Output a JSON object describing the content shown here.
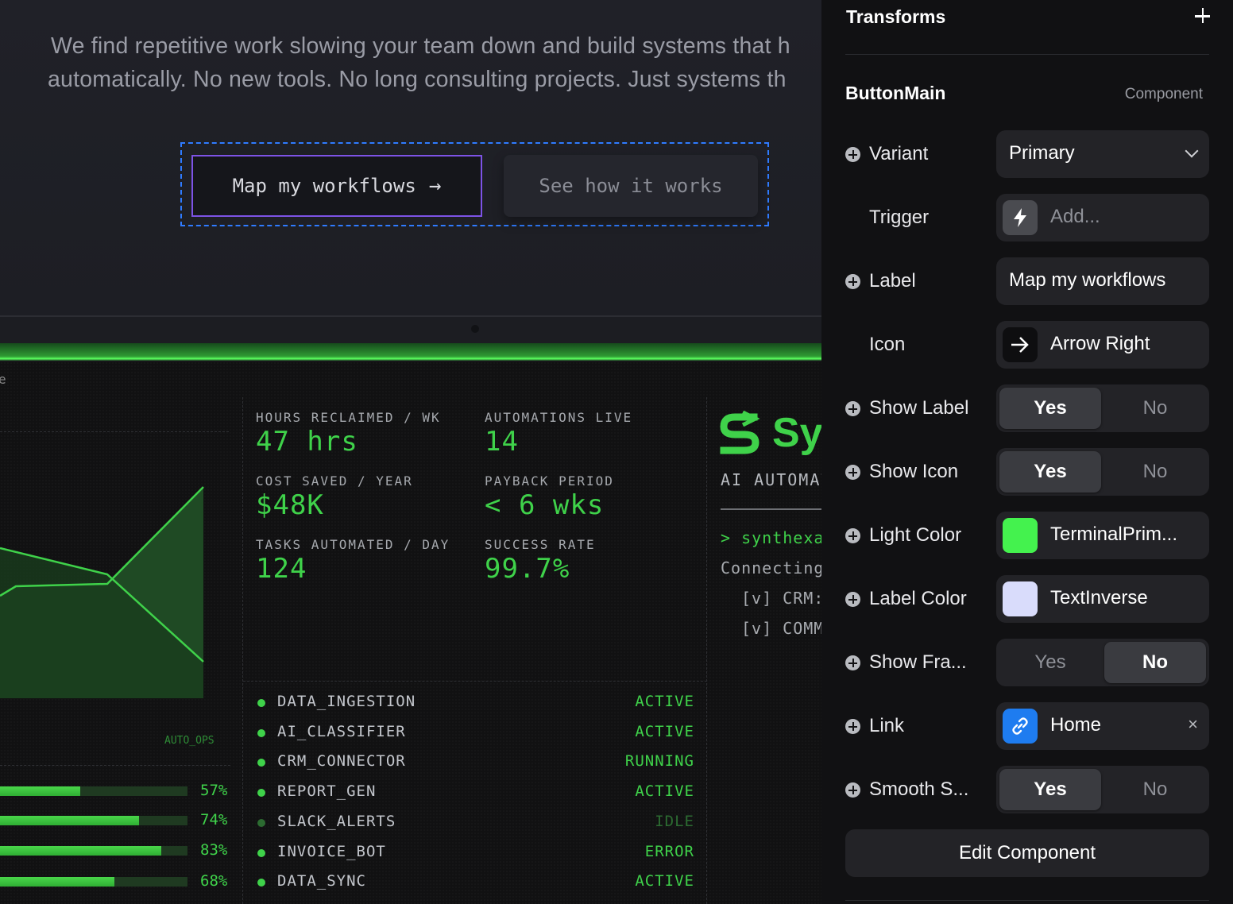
{
  "hero": {
    "line1": "We find repetitive work slowing your team down and build systems that h",
    "line2": "automatically. No new tools. No long consulting projects. Just systems th",
    "primary_cta": "Map my workflows",
    "secondary_cta": "See how it works"
  },
  "dashboard": {
    "cut_text": "e",
    "chart_label": "AUTO_OPS",
    "bars": [
      {
        "percent_label": "57%",
        "fill": 0.43
      },
      {
        "percent_label": "74%",
        "fill": 0.74
      },
      {
        "percent_label": "83%",
        "fill": 0.86
      },
      {
        "percent_label": "68%",
        "fill": 0.61
      }
    ],
    "metrics": [
      {
        "label": "HOURS RECLAIMED / WK",
        "value": "47 hrs"
      },
      {
        "label": "AUTOMATIONS LIVE",
        "value": "14"
      },
      {
        "label": "COST SAVED / YEAR",
        "value": "$48K"
      },
      {
        "label": "PAYBACK PERIOD",
        "value": "< 6 wks"
      },
      {
        "label": "TASKS AUTOMATED / DAY",
        "value": "124"
      },
      {
        "label": "SUCCESS RATE",
        "value": "99.7%"
      }
    ],
    "processes": [
      {
        "name": "DATA_INGESTION",
        "status": "ACTIVE"
      },
      {
        "name": "AI_CLASSIFIER",
        "status": "ACTIVE"
      },
      {
        "name": "CRM_CONNECTOR",
        "status": "RUNNING"
      },
      {
        "name": "REPORT_GEN",
        "status": "ACTIVE"
      },
      {
        "name": "SLACK_ALERTS",
        "status": "IDLE"
      },
      {
        "name": "INVOICE_BOT",
        "status": "ERROR"
      },
      {
        "name": "DATA_SYNC",
        "status": "ACTIVE"
      }
    ],
    "brand": {
      "name": "Sy",
      "subtitle": "AI AUTOMAT",
      "terminal": [
        "> synthexa",
        "Connecting",
        "[v] CRM:",
        "[v] COMM"
      ]
    }
  },
  "panel": {
    "title": "Transforms",
    "component_name": "ButtonMain",
    "component_type": "Component",
    "props": {
      "variant": {
        "label": "Variant",
        "value": "Primary"
      },
      "trigger": {
        "label": "Trigger",
        "placeholder": "Add..."
      },
      "label": {
        "label": "Label",
        "value": "Map my workflows"
      },
      "icon": {
        "label": "Icon",
        "value": "Arrow Right"
      },
      "show_label": {
        "label": "Show Label",
        "yes": "Yes",
        "no": "No",
        "selected": "Yes"
      },
      "show_icon": {
        "label": "Show Icon",
        "yes": "Yes",
        "no": "No",
        "selected": "Yes"
      },
      "light_color": {
        "label": "Light Color",
        "value": "TerminalPrim...",
        "color": "#44f24e"
      },
      "label_color": {
        "label": "Label Color",
        "value": "TextInverse",
        "color": "#d9dcfb"
      },
      "show_frame": {
        "label": "Show Fra...",
        "yes": "Yes",
        "no": "No",
        "selected": "No"
      },
      "link": {
        "label": "Link",
        "value": "Home",
        "clear": "×"
      },
      "smooth_scroll": {
        "label": "Smooth S...",
        "yes": "Yes",
        "no": "No",
        "selected": "Yes"
      }
    },
    "edit_button": "Edit Component"
  },
  "colors": {
    "terminal_green": "#3fd24a",
    "selection_blue": "#2f7bff",
    "primary_border": "#7d53e6",
    "link_blue": "#1e7cf0"
  }
}
